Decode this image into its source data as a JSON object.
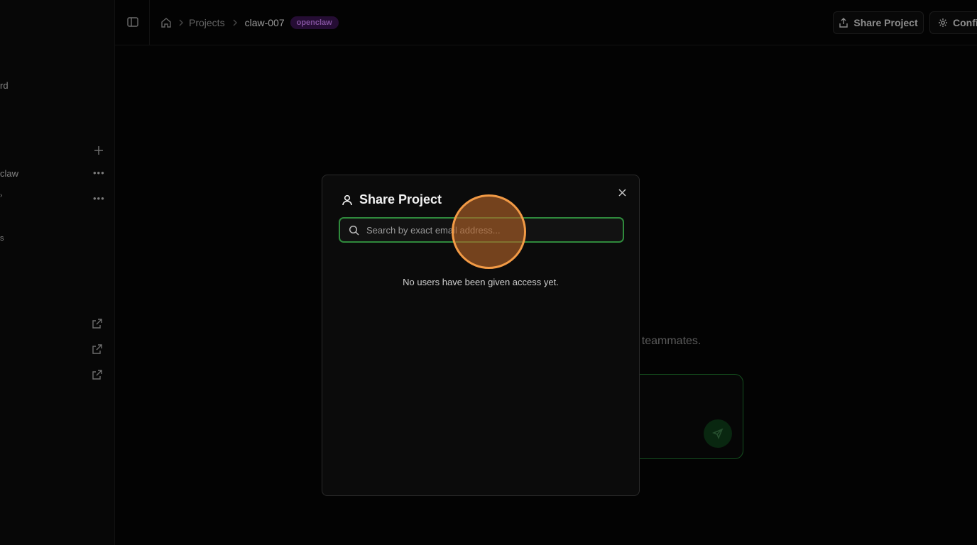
{
  "sidebar": {
    "items": [
      {
        "label": "rd"
      },
      {
        "label": "claw"
      },
      {
        "label": "s"
      }
    ]
  },
  "topbar": {
    "breadcrumb": {
      "projects": "Projects",
      "current": "claw-007",
      "badge": "openclaw"
    },
    "share_label": "Share Project",
    "config_label": "Confi"
  },
  "main": {
    "hint_text": "r teammates."
  },
  "modal": {
    "title": "Share Project",
    "search_placeholder": "Search by exact email address...",
    "empty_message": "No users have been given access yet."
  },
  "colors": {
    "accent_green": "#2f8a3c",
    "badge_purple": "#c57bf0",
    "cursor_orange": "#f29a45"
  }
}
